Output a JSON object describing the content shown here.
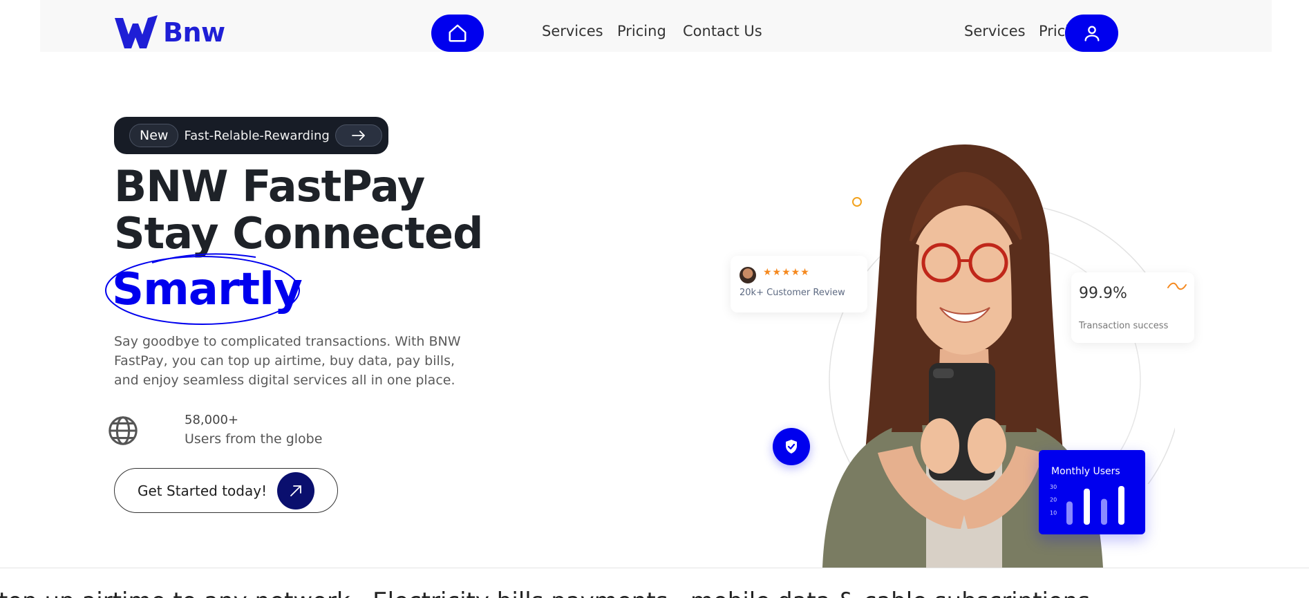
{
  "nav": {
    "logo_text": "Bnw",
    "center_links": [
      "Services",
      "Pricing",
      "Contact Us"
    ],
    "right_links": [
      "Services",
      "Pricing"
    ]
  },
  "hero": {
    "badge_new": "New",
    "badge_text": "Fast-Relable-Rewarding",
    "headline_line1": "BNW FastPay",
    "headline_line2": "Stay Connected",
    "headline_highlight": "Smartly",
    "description": "Say goodbye to complicated transactions. With BNW FastPay, you can top up airtime, buy data, pay bills, and enjoy seamless digital services all in one place.",
    "users_count": "58,000+",
    "users_label": "Users from the globe",
    "cta_label": "Get Started today!"
  },
  "cards": {
    "review_stars": "★★★★★",
    "review_text": "20k+ Customer Review",
    "success_pct": "99.9%",
    "success_label": "Transaction success",
    "monthly_title": "Monthly Users"
  },
  "chart_data": {
    "type": "bar",
    "title": "Monthly Users",
    "y_ticks": [
      30,
      20,
      10
    ],
    "ylim": [
      0,
      30
    ],
    "values": [
      18,
      28,
      20,
      30
    ],
    "colors": [
      "#8a8aff",
      "#ffffff",
      "#8a8aff",
      "#ffffff"
    ]
  },
  "ticker": {
    "text": "top up airtime to any network  ·  Electricity bills payments  ·  mobile data & cable subscriptions"
  },
  "colors": {
    "brand_blue": "#0000ee",
    "dark": "#171c26",
    "accent_orange": "#f5891f"
  },
  "icons": {
    "home": "home-icon",
    "user": "user-icon",
    "globe": "globe-icon",
    "arrow": "arrow-right-icon",
    "cta_arrow": "arrow-up-right-icon",
    "shield": "shield-check-icon"
  }
}
